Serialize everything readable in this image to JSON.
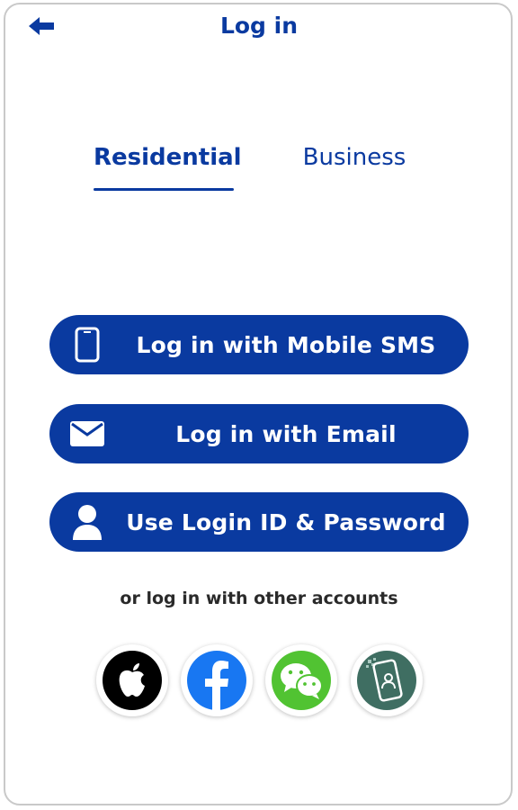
{
  "header": {
    "title": "Log in",
    "back_icon": "arrow-left-icon"
  },
  "tabs": [
    {
      "label": "Residential",
      "active": true
    },
    {
      "label": "Business",
      "active": false
    }
  ],
  "login_options": [
    {
      "label": "Log in with Mobile SMS",
      "icon": "mobile-phone-icon"
    },
    {
      "label": "Log in with Email",
      "icon": "envelope-icon"
    },
    {
      "label": "Use Login ID & Password",
      "icon": "user-icon"
    }
  ],
  "other_accounts": {
    "label": "or log in with other accounts",
    "providers": [
      {
        "icon": "apple-icon"
      },
      {
        "icon": "facebook-icon"
      },
      {
        "icon": "wechat-icon"
      },
      {
        "icon": "mobile-app-id-icon"
      }
    ]
  },
  "colors": {
    "primary": "#0a3aa0",
    "facebook": "#1877f2",
    "wechat": "#51c332",
    "app": "#3f6e62"
  }
}
